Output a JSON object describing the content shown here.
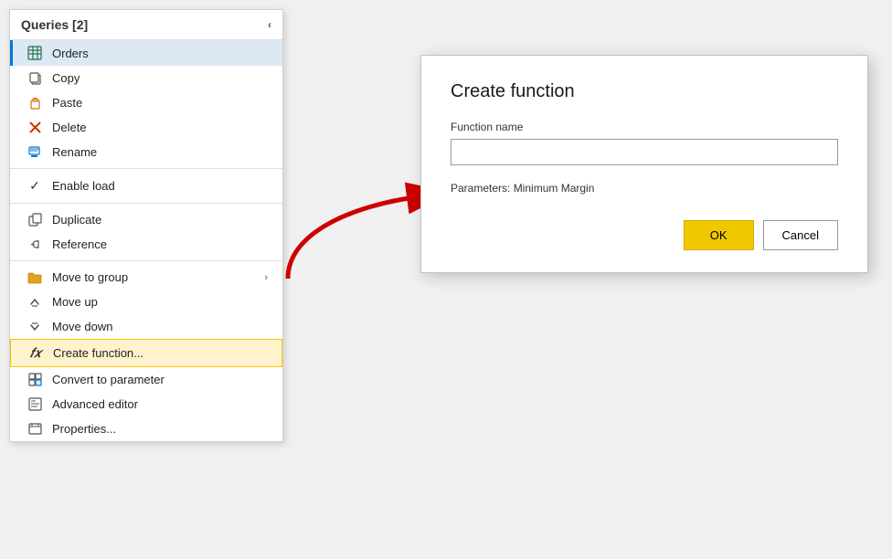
{
  "header": {
    "title": "Queries [2]",
    "collapse_label": "<"
  },
  "menu": {
    "active_item": "Orders",
    "items": [
      {
        "id": "copy",
        "label": "Copy",
        "icon": "copy",
        "has_submenu": false
      },
      {
        "id": "paste",
        "label": "Paste",
        "icon": "paste",
        "has_submenu": false
      },
      {
        "id": "delete",
        "label": "Delete",
        "icon": "delete",
        "has_submenu": false
      },
      {
        "id": "rename",
        "label": "Rename",
        "icon": "rename",
        "has_submenu": false
      },
      {
        "id": "enable-load",
        "label": "Enable load",
        "icon": "check",
        "has_submenu": false
      },
      {
        "id": "duplicate",
        "label": "Duplicate",
        "icon": "duplicate",
        "has_submenu": false
      },
      {
        "id": "reference",
        "label": "Reference",
        "icon": "reference",
        "has_submenu": false
      },
      {
        "id": "move-to-group",
        "label": "Move to group",
        "icon": "folder",
        "has_submenu": true
      },
      {
        "id": "move-up",
        "label": "Move up",
        "icon": "moveup",
        "has_submenu": false
      },
      {
        "id": "move-down",
        "label": "Move down",
        "icon": "movedown",
        "has_submenu": false
      },
      {
        "id": "create-function",
        "label": "Create function...",
        "icon": "fx",
        "has_submenu": false,
        "highlighted": true
      },
      {
        "id": "convert-to-parameter",
        "label": "Convert to parameter",
        "icon": "convert",
        "has_submenu": false
      },
      {
        "id": "advanced-editor",
        "label": "Advanced editor",
        "icon": "advanced",
        "has_submenu": false
      },
      {
        "id": "properties",
        "label": "Properties...",
        "icon": "properties",
        "has_submenu": false
      }
    ]
  },
  "dialog": {
    "title": "Create function",
    "function_name_label": "Function name",
    "function_name_value": "",
    "function_name_placeholder": "",
    "parameters_label": "Parameters: Minimum Margin",
    "ok_label": "OK",
    "cancel_label": "Cancel"
  }
}
